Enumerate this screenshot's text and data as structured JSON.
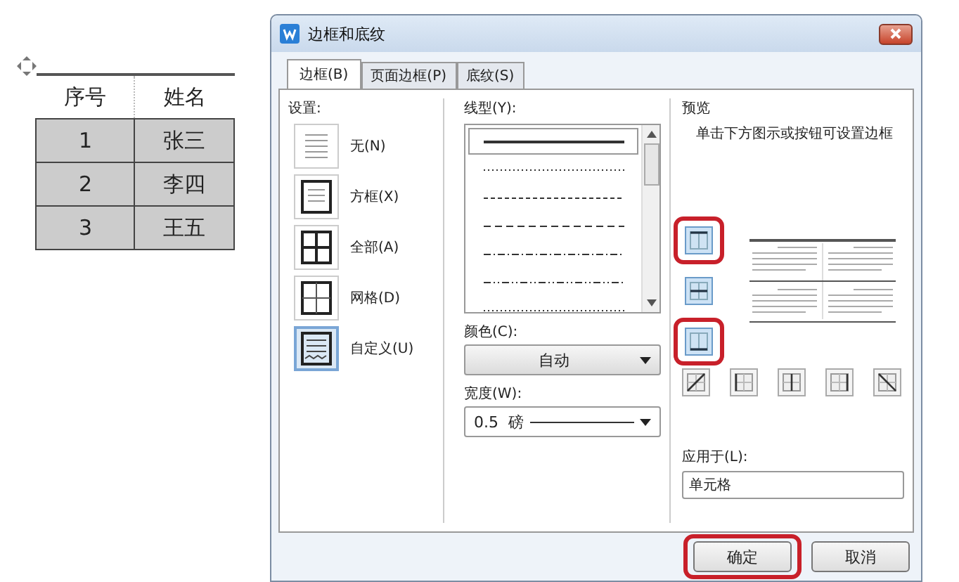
{
  "table": {
    "columns": [
      "序号",
      "姓名"
    ],
    "rows": [
      [
        "1",
        "张三"
      ],
      [
        "2",
        "李四"
      ],
      [
        "3",
        "王五"
      ]
    ]
  },
  "dialog": {
    "title": "边框和底纹",
    "tabs": [
      {
        "label": "边框(B)",
        "selected": true
      },
      {
        "label": "页面边框(P)",
        "selected": false
      },
      {
        "label": "底纹(S)",
        "selected": false
      }
    ],
    "settings": {
      "label": "设置:",
      "items": [
        {
          "label": "无(N)",
          "kind": "none",
          "selected": false
        },
        {
          "label": "方框(X)",
          "kind": "box",
          "selected": false
        },
        {
          "label": "全部(A)",
          "kind": "all",
          "selected": false
        },
        {
          "label": "网格(D)",
          "kind": "grid",
          "selected": false
        },
        {
          "label": "自定义(U)",
          "kind": "custom",
          "selected": true
        }
      ]
    },
    "line_style": {
      "label": "线型(Y):",
      "styles": [
        {
          "kind": "solid",
          "selected": true
        },
        {
          "kind": "dotted",
          "selected": false
        },
        {
          "kind": "dashed",
          "selected": false
        },
        {
          "kind": "long-dash",
          "selected": false
        },
        {
          "kind": "dash-dot",
          "selected": false
        },
        {
          "kind": "dash-dot-dot",
          "selected": false
        },
        {
          "kind": "dotted",
          "selected": false
        }
      ]
    },
    "color": {
      "label": "颜色(C):",
      "value": "自动"
    },
    "width": {
      "label": "宽度(W):",
      "value": "0.5  磅"
    },
    "preview": {
      "label": "预览",
      "hint": "单击下方图示或按钮可设置边框",
      "side_buttons": [
        {
          "kind": "top",
          "on": true,
          "highlighted": true
        },
        {
          "kind": "middle",
          "on": true,
          "highlighted": false
        },
        {
          "kind": "bottom",
          "on": true,
          "highlighted": true
        }
      ],
      "bottom_buttons": [
        {
          "kind": "diag-up",
          "on": false
        },
        {
          "kind": "left",
          "on": false
        },
        {
          "kind": "center",
          "on": false
        },
        {
          "kind": "right",
          "on": false
        },
        {
          "kind": "diag-down",
          "on": false
        }
      ]
    },
    "apply_to": {
      "label": "应用于(L):",
      "value": "单元格"
    },
    "buttons": [
      {
        "label": "确定",
        "highlighted": true
      },
      {
        "label": "取消",
        "highlighted": false
      }
    ]
  }
}
